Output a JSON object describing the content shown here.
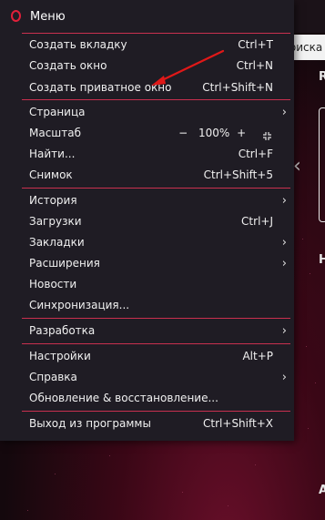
{
  "background": {
    "search_text": "поиска",
    "heading_r": "R",
    "heading_h": "H",
    "heading_a": "A",
    "prev_arrow": "‹"
  },
  "menu": {
    "title": "Меню",
    "items": [
      {
        "label": "Создать вкладку",
        "shortcut": "Ctrl+T"
      },
      {
        "label": "Создать окно",
        "shortcut": "Ctrl+N"
      },
      {
        "label": "Создать приватное окно",
        "shortcut": "Ctrl+Shift+N"
      },
      {
        "label": "Страница",
        "chevron": "›"
      },
      {
        "label": "Масштаб",
        "zoom_minus": "−",
        "zoom_value": "100%",
        "zoom_plus": "+"
      },
      {
        "label": "Найти...",
        "shortcut": "Ctrl+F"
      },
      {
        "label": "Снимок",
        "shortcut": "Ctrl+Shift+5"
      },
      {
        "label": "История",
        "chevron": "›"
      },
      {
        "label": "Загрузки",
        "shortcut": "Ctrl+J"
      },
      {
        "label": "Закладки",
        "chevron": "›"
      },
      {
        "label": "Расширения",
        "chevron": "›"
      },
      {
        "label": "Новости"
      },
      {
        "label": "Синхронизация..."
      },
      {
        "label": "Разработка",
        "chevron": "›"
      },
      {
        "label": "Настройки",
        "shortcut": "Alt+P"
      },
      {
        "label": "Справка",
        "chevron": "›"
      },
      {
        "label": "Обновление & восстановление..."
      },
      {
        "label": "Выход из программы",
        "shortcut": "Ctrl+Shift+X"
      }
    ]
  },
  "colors": {
    "accent": "#c9304f",
    "menu_bg": "#1f1c24",
    "annotation_arrow": "#e01818"
  }
}
